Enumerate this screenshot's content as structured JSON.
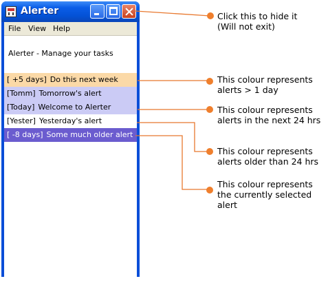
{
  "window": {
    "title": "Alerter",
    "menu": [
      "File",
      "View",
      "Help"
    ],
    "subtitle": "Alerter - Manage your tasks"
  },
  "alerts": [
    {
      "tag": "[ +5 days]",
      "text": "Do this next week",
      "kind": "more-than-1-day",
      "color": "#fbd9a7"
    },
    {
      "tag": "[Tomm]",
      "text": "Tomorrow's alert",
      "kind": "next-24-hrs",
      "color": "#cbcbf5"
    },
    {
      "tag": "[Today]",
      "text": "Welcome to Alerter",
      "kind": "next-24-hrs",
      "color": "#cbcbf5"
    },
    {
      "tag": "[Yester]",
      "text": "Yesterday's alert",
      "kind": "older-than-24-hrs",
      "color": "#ffffff"
    },
    {
      "tag": "[ -8 days]",
      "text": "Some much older alert",
      "kind": "selected",
      "color": "#6b5ccf"
    }
  ],
  "callouts": [
    {
      "line1": "Click this to hide it",
      "line2": "(Will not exit)",
      "line3": ""
    },
    {
      "line1": "This colour represents",
      "line2": "alerts > 1 day",
      "line3": ""
    },
    {
      "line1": "This colour represents",
      "line2": "alerts in the next 24 hrs",
      "line3": ""
    },
    {
      "line1": "This colour represents",
      "line2": "alerts older than 24 hrs",
      "line3": ""
    },
    {
      "line1": "This colour represents",
      "line2": "the currently selected",
      "line3": "alert"
    }
  ],
  "colors": {
    "callout_line": "#e8782e",
    "titlebar": "#0a56df",
    "close_button": "#d5542f"
  }
}
